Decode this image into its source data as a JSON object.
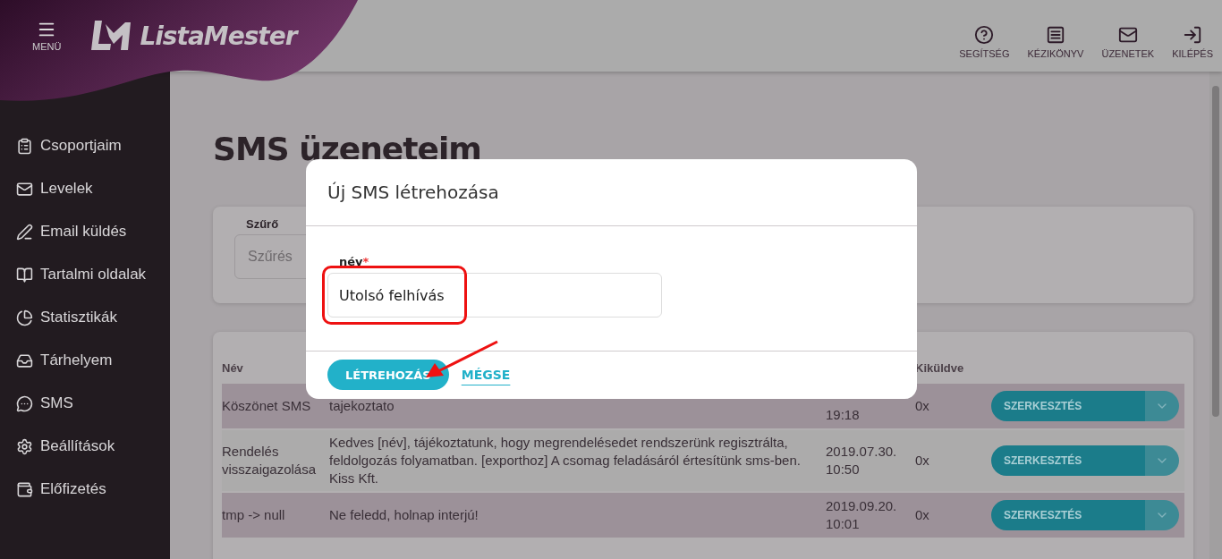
{
  "header": {
    "menu_label": "MENÜ",
    "logo_text": "ListaMester",
    "nav": [
      {
        "kind": "help",
        "label": "SEGÍTSÉG"
      },
      {
        "kind": "manual",
        "label": "KÉZIKÖNYV"
      },
      {
        "kind": "messages",
        "label": "ÜZENETEK"
      },
      {
        "kind": "logout",
        "label": "KILÉPÉS"
      }
    ]
  },
  "sidebar": {
    "items": [
      {
        "kind": "groups",
        "label": "Csoportjaim"
      },
      {
        "kind": "letters",
        "label": "Levelek"
      },
      {
        "kind": "send",
        "label": "Email küldés"
      },
      {
        "kind": "pages",
        "label": "Tartalmi oldalak"
      },
      {
        "kind": "stats",
        "label": "Statisztikák"
      },
      {
        "kind": "storage",
        "label": "Tárhelyem"
      },
      {
        "kind": "sms",
        "label": "SMS"
      },
      {
        "kind": "settings",
        "label": "Beállítások"
      },
      {
        "kind": "subscription",
        "label": "Előfizetés"
      }
    ]
  },
  "page": {
    "title": "SMS üzeneteim"
  },
  "filter": {
    "label": "Szűrő",
    "placeholder": "Szűrés"
  },
  "table": {
    "name_column": "Név",
    "sent_column": "Kiküldve",
    "rows": [
      {
        "name": "Köszönet SMS",
        "message": "tajekoztato",
        "time": "19:18",
        "sent": "0x",
        "action": "SZERKESZTÉS"
      },
      {
        "name": "Rendelés visszaigazolása",
        "message": "Kedves [név], tájékoztatunk, hogy megrendelésedet rendszerünk regisztrálta, feldolgozás folyamatban. [exporthoz] A csomag feladásáról értesítünk sms-ben. Kiss Kft.",
        "date": "2019.07.30.",
        "time": "10:50",
        "sent": "0x",
        "action": "SZERKESZTÉS"
      },
      {
        "name": "tmp -> null",
        "message": "Ne feledd, holnap interjú!",
        "date": "2019.09.20.",
        "time": "10:01",
        "sent": "0x",
        "action": "SZERKESZTÉS"
      }
    ]
  },
  "dialog": {
    "title": "Új SMS létrehozása",
    "field_label": "név",
    "required_mark": "*",
    "field_value": "Utolsó felhívás",
    "primary_button": "LÉTREHOZÁS",
    "cancel_link": "MÉGSE"
  }
}
